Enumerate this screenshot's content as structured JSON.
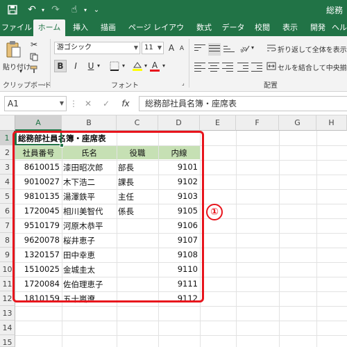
{
  "title_bar": {
    "save_icon": "save-icon",
    "undo_icon": "undo-icon",
    "redo_icon": "redo-icon",
    "touch_icon": "touch-mode-icon",
    "customize_icon": "customize-icon",
    "doc_title": "総務"
  },
  "tabs": [
    "ファイル",
    "ホーム",
    "挿入",
    "描画",
    "ページ レイアウト",
    "数式",
    "データ",
    "校閲",
    "表示",
    "開発",
    "ヘルプ"
  ],
  "ribbon": {
    "paste_label": "貼り付け",
    "clipboard_group": "クリップボード",
    "font_name": "游ゴシック",
    "font_size": "11",
    "grow_font": "A",
    "shrink_font": "A",
    "bold": "B",
    "italic": "I",
    "underline": "U",
    "font_color_letter": "A",
    "font_group": "フォント",
    "wrap_text": "折り返して全体を表示する",
    "merge_center": "セルを結合して中央揃え",
    "align_group": "配置",
    "font_color": "#e8141c",
    "highlight_color": "#ffff00"
  },
  "formula_bar": {
    "name_box": "A1",
    "cancel": "✕",
    "enter": "✓",
    "fx": "fx",
    "content": "総務部社員名簿・座席表"
  },
  "columns": [
    "A",
    "B",
    "C",
    "D",
    "E",
    "F",
    "G",
    "H"
  ],
  "rows": [
    "1",
    "2",
    "3",
    "4",
    "5",
    "6",
    "7",
    "8",
    "9",
    "10",
    "11",
    "12",
    "13",
    "14",
    "15"
  ],
  "sheet": {
    "title": "総務部社員名簿・座席表",
    "headers": [
      "社員番号",
      "氏名",
      "役職",
      "内線"
    ],
    "records": [
      {
        "id": "8610015",
        "name": "漆田昭次郎",
        "role": "部長",
        "ext": "9101"
      },
      {
        "id": "9010027",
        "name": "木下浩二",
        "role": "課長",
        "ext": "9102"
      },
      {
        "id": "9810135",
        "name": "湯澤鉄平",
        "role": "主任",
        "ext": "9103"
      },
      {
        "id": "1720045",
        "name": "相川美智代",
        "role": "係長",
        "ext": "9105"
      },
      {
        "id": "9510179",
        "name": "河原木恭平",
        "role": "",
        "ext": "9106"
      },
      {
        "id": "9620078",
        "name": "桜井恵子",
        "role": "",
        "ext": "9107"
      },
      {
        "id": "1320157",
        "name": "田中幸恵",
        "role": "",
        "ext": "9108"
      },
      {
        "id": "1510025",
        "name": "金城圭太",
        "role": "",
        "ext": "9110"
      },
      {
        "id": "1720084",
        "name": "佐伯理恵子",
        "role": "",
        "ext": "9111"
      },
      {
        "id": "1810159",
        "name": "五十嵐遼",
        "role": "",
        "ext": "9112"
      }
    ],
    "header_fill": "#c6e0b4"
  },
  "annotation": {
    "badge": "①",
    "color": "#e8141c"
  }
}
